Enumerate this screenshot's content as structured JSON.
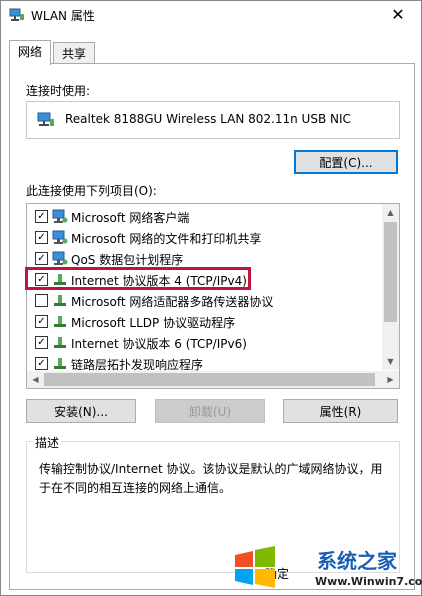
{
  "window": {
    "title": "WLAN 属性",
    "close_label": "✕"
  },
  "tabs": [
    {
      "label": "网络",
      "active": true
    },
    {
      "label": "共享",
      "active": false
    }
  ],
  "connect_using": {
    "label": "连接时使用:",
    "adapter": "Realtek 8188GU Wireless LAN 802.11n USB NIC",
    "configure_button": "配置(C)..."
  },
  "items_section": {
    "label": "此连接使用下列项目(O):",
    "items": [
      {
        "label": "Microsoft 网络客户端",
        "checked": true,
        "icon": "network-client-icon"
      },
      {
        "label": "Microsoft 网络的文件和打印机共享",
        "checked": true,
        "icon": "network-client-icon"
      },
      {
        "label": "QoS 数据包计划程序",
        "checked": true,
        "icon": "network-client-icon"
      },
      {
        "label": "Internet 协议版本 4 (TCP/IPv4)",
        "checked": true,
        "icon": "protocol-icon",
        "selected": true
      },
      {
        "label": "Microsoft 网络适配器多路传送器协议",
        "checked": false,
        "icon": "protocol-icon"
      },
      {
        "label": "Microsoft LLDP 协议驱动程序",
        "checked": true,
        "icon": "protocol-icon"
      },
      {
        "label": "Internet 协议版本 6 (TCP/IPv6)",
        "checked": true,
        "icon": "protocol-icon"
      },
      {
        "label": "链路层拓扑发现响应程序",
        "checked": true,
        "icon": "protocol-icon"
      }
    ]
  },
  "buttons": {
    "install": "安装(N)...",
    "uninstall": "卸载(U)",
    "properties": "属性(R)"
  },
  "description": {
    "title": "描述",
    "text": "传输控制协议/Internet 协议。该协议是默认的广域网络协议，用于在不同的相互连接的网络上通信。"
  },
  "footer": {
    "partial_label": "确定"
  },
  "watermark": {
    "brand": "系统之家",
    "url": "Www.Winwin7.com"
  },
  "colors": {
    "highlight_border": "#c0143c",
    "accent": "#0078d7"
  }
}
